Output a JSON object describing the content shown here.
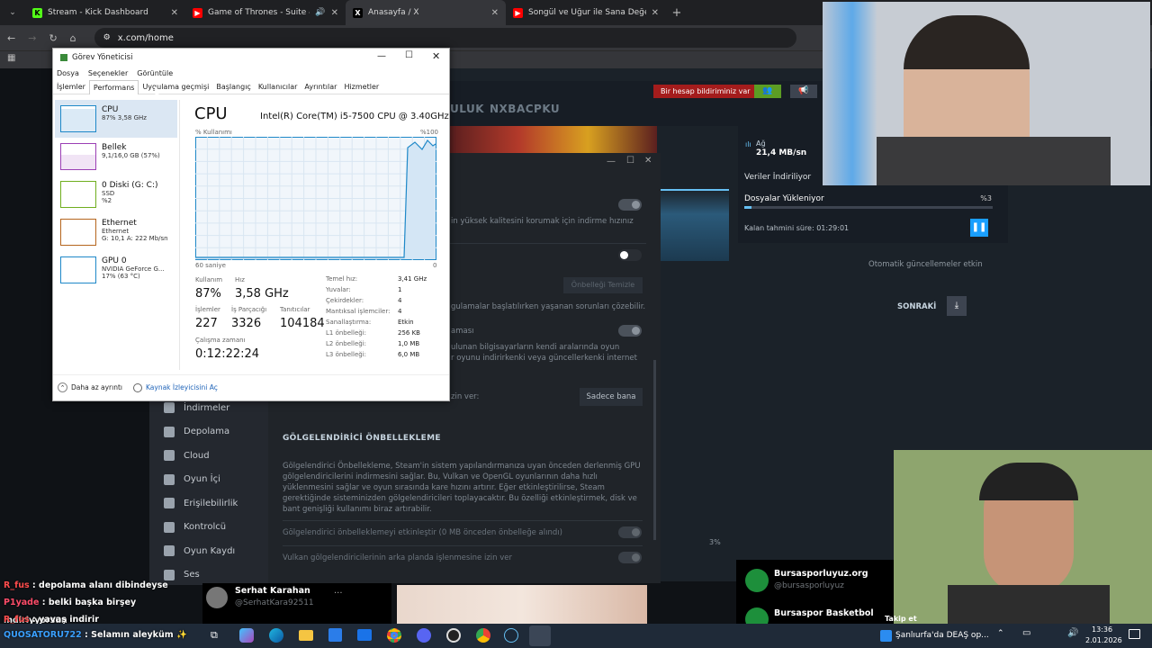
{
  "browser": {
    "tabs": [
      {
        "title": "Stream - Kick Dashboard",
        "icon": "kick-icon",
        "color": "#53fc18"
      },
      {
        "title": "Game of Thrones - Suite &",
        "icon": "youtube-icon",
        "color": "#ff0000"
      },
      {
        "title": "Anasayfa / X",
        "icon": "x-icon",
        "color": "#ffffff"
      },
      {
        "title": "Songül ve Uğur ile Sana Değer",
        "icon": "youtube-icon",
        "color": "#ff0000"
      }
    ],
    "url": "x.com/home"
  },
  "task_manager": {
    "title": "Görev Yöneticisi",
    "menu": [
      "Dosya",
      "Seçenekler",
      "Görüntüle"
    ],
    "tabs": [
      "İşlemler",
      "Performans",
      "Uygulama geçmişi",
      "Başlangıç",
      "Kullanıcılar",
      "Ayrıntılar",
      "Hizmetler"
    ],
    "resources": [
      {
        "name": "CPU",
        "l1": "87% 3,58 GHz",
        "l2": "",
        "l3": "",
        "color": "#1e88c8"
      },
      {
        "name": "Bellek",
        "l1": "9,1/16,0 GB (57%)",
        "l2": "",
        "l3": "",
        "color": "#9b3fb4"
      },
      {
        "name": "0 Diski (G: C:)",
        "l1": "SSD",
        "l2": "%2",
        "l3": "",
        "color": "#6fae1e"
      },
      {
        "name": "Ethernet",
        "l1": "Ethernet",
        "l2": "G: 10,1  A: 222 Mb/sn",
        "l3": "",
        "color": "#b5651d"
      },
      {
        "name": "GPU 0",
        "l1": "NVIDIA GeForce G...",
        "l2": "17% (63 °C)",
        "l3": "",
        "color": "#1e88c8"
      }
    ],
    "cpu": {
      "heading": "CPU",
      "model": "Intel(R) Core(TM) i5-7500 CPU @ 3.40GHz",
      "usage_label": "% Kullanımı",
      "max_label": "%100",
      "time_label": "60 saniye",
      "zero_label": "0",
      "usage_title": "Kullanım",
      "usage": "87%",
      "speed_title": "Hız",
      "speed": "3,58 GHz",
      "proc_title": "İşlemler",
      "proc": "227",
      "threads_title": "İş Parçacığı",
      "threads": "3326",
      "handles_title": "Tanıtıcılar",
      "handles": "104184",
      "uptime_title": "Çalışma zamanı",
      "uptime": "0:12:22:24",
      "details": [
        {
          "k": "Temel hız:",
          "v": "3,41 GHz"
        },
        {
          "k": "Yuvalar:",
          "v": "1"
        },
        {
          "k": "Çekirdekler:",
          "v": "4"
        },
        {
          "k": "Mantıksal işlemciler:",
          "v": "4"
        },
        {
          "k": "Sanallaştırma:",
          "v": "Etkin"
        },
        {
          "k": "L1 önbelleği:",
          "v": "256 KB"
        },
        {
          "k": "L2 önbelleği:",
          "v": "1,0 MB"
        },
        {
          "k": "L3 önbelleği:",
          "v": "6,0 MB"
        }
      ]
    },
    "footer_less": "Daha az ayrıntı",
    "footer_monitor": "Kaynak İzleyicisini Aç"
  },
  "steam": {
    "report_btn": "Bir hesap bildiriminiz var",
    "nav": [
      "ULUK",
      "NXBACPKU"
    ],
    "download": {
      "down_label": "Ağ",
      "rate": "21,4 MB/sn",
      "row1": "Veriler İndiriliyor",
      "row2": "Dosyalar Yükleniyor",
      "row2_pct": "%3",
      "eta": "Kalan tahmini süre: 01:29:01",
      "auto_update": "Otomatik güncellemeler etkin",
      "next": "SONRAKİ",
      "pct_bottom": "3%"
    },
    "settings": {
      "text_quality": "in yüksek kalitesini korumak için indirme hızınız",
      "clear_cache_btn": "Önbelleği Temizle",
      "cache_note": "gulamalar başlatılırken yaşanan sorunları çözebilir.",
      "lan_label": "aması",
      "lan_desc1": "ulunan bilgisayarların kendi aralarında oyun",
      "lan_desc2": "r oyunu indirirkenki veya güncellerkenki internet",
      "allow_label": "zin ver:",
      "only_me_btn": "Sadece bana",
      "shader_title": "GÖLGELENDİRİCİ ÖNBELLEKLEME",
      "shader_desc": "Gölgelendirici Önbellekleme, Steam'in sistem yapılandırmanıza uyan önceden derlenmiş GPU gölgelendiricilerini indirmesini sağlar. Bu, Vulkan ve OpenGL oyunlarının daha hızlı yüklenmesini sağlar ve oyun sırasında kare hızını artırır. Eğer etkinleştirilirse, Steam gerektiğinde sisteminizden gölgelendiricileri toplayacaktır. Bu özelliği etkinleştirmek, disk ve bant genişliği kullanımı biraz artırabilir.",
      "shader_opt1": "Gölgelendirici önbelleklemeyi etkinleştir (0 MB önceden önbelleğe alındı)",
      "shader_opt2": "Vulkan gölgelendiricilerinin arka planda işlenmesine izin ver"
    },
    "sidebar": [
      {
        "label": "İndirmeler",
        "icon": "download-icon"
      },
      {
        "label": "Depolama",
        "icon": "storage-icon"
      },
      {
        "label": "Cloud",
        "icon": "cloud-icon"
      },
      {
        "label": "Oyun İçi",
        "icon": "ingame-icon"
      },
      {
        "label": "Erişilebilirlik",
        "icon": "accessibility-icon"
      },
      {
        "label": "Kontrolcü",
        "icon": "controller-icon"
      },
      {
        "label": "Oyun Kaydı",
        "icon": "recording-icon"
      },
      {
        "label": "Ses",
        "icon": "microphone-icon"
      }
    ]
  },
  "twitter": {
    "user1_name": "Serhat Karahan",
    "user1_handle": "@SerhatKara92511",
    "suggest1_name": "Bursasporluyuz.org",
    "suggest1_handle": "@bursasporluyuz",
    "suggest2_name": "Bursaspor Basketbol",
    "follow_label": "Takip et"
  },
  "chat": [
    {
      "user": "R_fus",
      "msg": "depolama alanı dibindeyse",
      "color": "#ff4d4d"
    },
    {
      "user": "P1yade",
      "msg": "belki başka birşey indiriyyorsun",
      "color": "#ff4d6a"
    },
    {
      "user": "R_fus",
      "msg": "yavaş indirir",
      "color": "#ff4d4d"
    },
    {
      "user": "QUOSATORU722",
      "msg": "Selamın aleyküm",
      "color": "#3aa0ff"
    }
  ],
  "taskbar": {
    "news": "Şanlıurfa'da DEAŞ op...",
    "time": "13:36",
    "date": "2.01.2026"
  }
}
